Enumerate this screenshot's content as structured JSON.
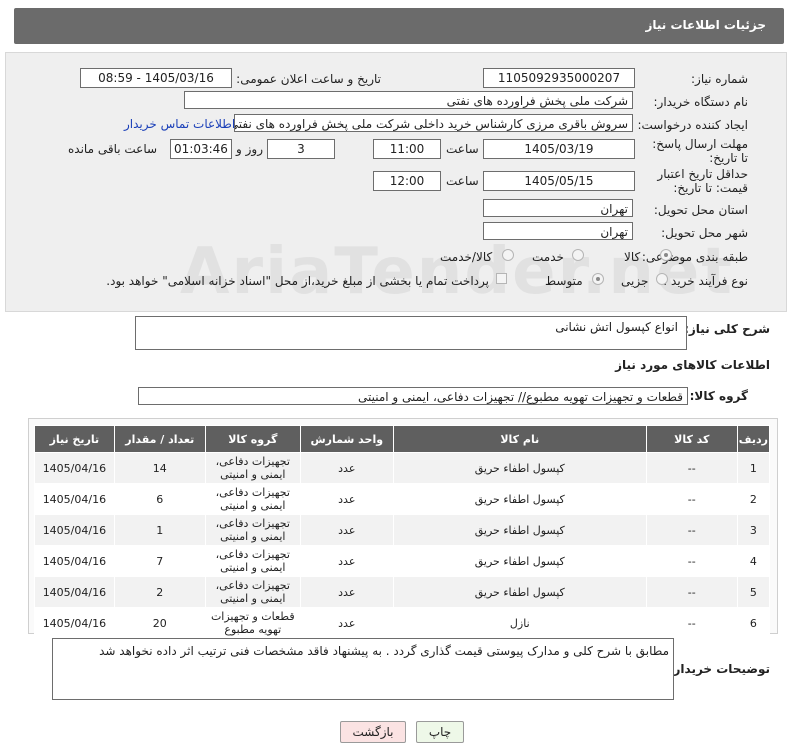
{
  "header": {
    "title": "جزئیات اطلاعات نیاز"
  },
  "form": {
    "need_number_label": "شماره نیاز:",
    "need_number": "1105092935000207",
    "announce_label": "تاریخ و ساعت اعلان عمومی:",
    "announce_value": "1405/03/16 - 08:59",
    "buyer_label": "نام دستگاه خریدار:",
    "buyer_value": "شرکت ملی پخش فراورده های نفتی",
    "creator_label": "ایجاد کننده درخواست:",
    "creator_value": "سروش باقری مرزی کارشناس خرید داخلی شرکت ملی پخش فراورده های نفتی",
    "contact_link": "اطلاعات تماس خریدار",
    "deadline_label": "مهلت ارسال پاسخ: تا تاریخ:",
    "deadline_date": "1405/03/19",
    "time_label": "ساعت",
    "deadline_time": "11:00",
    "days_value": "3",
    "days_label": "روز و",
    "remaining_value": "01:03:46",
    "remaining_label": "ساعت باقی مانده",
    "validity_label": "حداقل تاریخ اعتبار قیمت: تا تاریخ:",
    "validity_date": "1405/05/15",
    "validity_time": "12:00",
    "province_label": "استان محل تحویل:",
    "province_value": "تهران",
    "city_label": "شهر محل تحویل:",
    "city_value": "تهران",
    "category_label": "طبقه بندی موضوعی:",
    "category_options": [
      "کالا",
      "خدمت",
      "کالا/خدمت"
    ],
    "category_selected": "کالا",
    "purchase_label": "نوع فرآیند خرید :",
    "purchase_options": [
      "جزیی",
      "متوسط"
    ],
    "purchase_selected": "متوسط",
    "payment_note": "پرداخت تمام یا بخشی از مبلغ خرید،از محل \"اسناد خزانه اسلامی\" خواهد بود."
  },
  "summary": {
    "label": "شرح کلی نیاز:",
    "value": "انواع کپسول اتش نشانی"
  },
  "goods": {
    "section_title": "اطلاعات کالاهای مورد نیاز",
    "group_label": "گروه کالا:",
    "group_value": "قطعات و تجهیزات تهویه مطبوع// تجهیزات دفاعی، ایمنی و امنیتی"
  },
  "table": {
    "headers": [
      "ردیف",
      "کد کالا",
      "نام کالا",
      "واحد شمارش",
      "گروه کالا",
      "تعداد / مقدار",
      "تاریخ نیاز"
    ],
    "rows": [
      [
        "1",
        "--",
        "کپسول اطفاء حریق",
        "عدد",
        "تجهیزات دفاعی، ایمنی و امنیتی",
        "14",
        "1405/04/16"
      ],
      [
        "2",
        "--",
        "کپسول اطفاء حریق",
        "عدد",
        "تجهیزات دفاعی، ایمنی و امنیتی",
        "6",
        "1405/04/16"
      ],
      [
        "3",
        "--",
        "کپسول اطفاء حریق",
        "عدد",
        "تجهیزات دفاعی، ایمنی و امنیتی",
        "1",
        "1405/04/16"
      ],
      [
        "4",
        "--",
        "کپسول اطفاء حریق",
        "عدد",
        "تجهیزات دفاعی، ایمنی و امنیتی",
        "7",
        "1405/04/16"
      ],
      [
        "5",
        "--",
        "کپسول اطفاء حریق",
        "عدد",
        "تجهیزات دفاعی، ایمنی و امنیتی",
        "2",
        "1405/04/16"
      ],
      [
        "6",
        "--",
        "نازل",
        "عدد",
        "قطعات و تجهیزات تهویه مطبوع",
        "20",
        "1405/04/16"
      ]
    ]
  },
  "buyer_notes": {
    "label": "توضیحات خریدار:",
    "value": "مطابق با شرح کلی و مدارک پیوستی قیمت گذاری گردد . به پیشنهاد فاقد مشخصات فنی ترتیب اثر داده نخواهد شد"
  },
  "buttons": {
    "print": "چاپ",
    "back": "بازگشت"
  },
  "watermark": "AriaTender.net"
}
